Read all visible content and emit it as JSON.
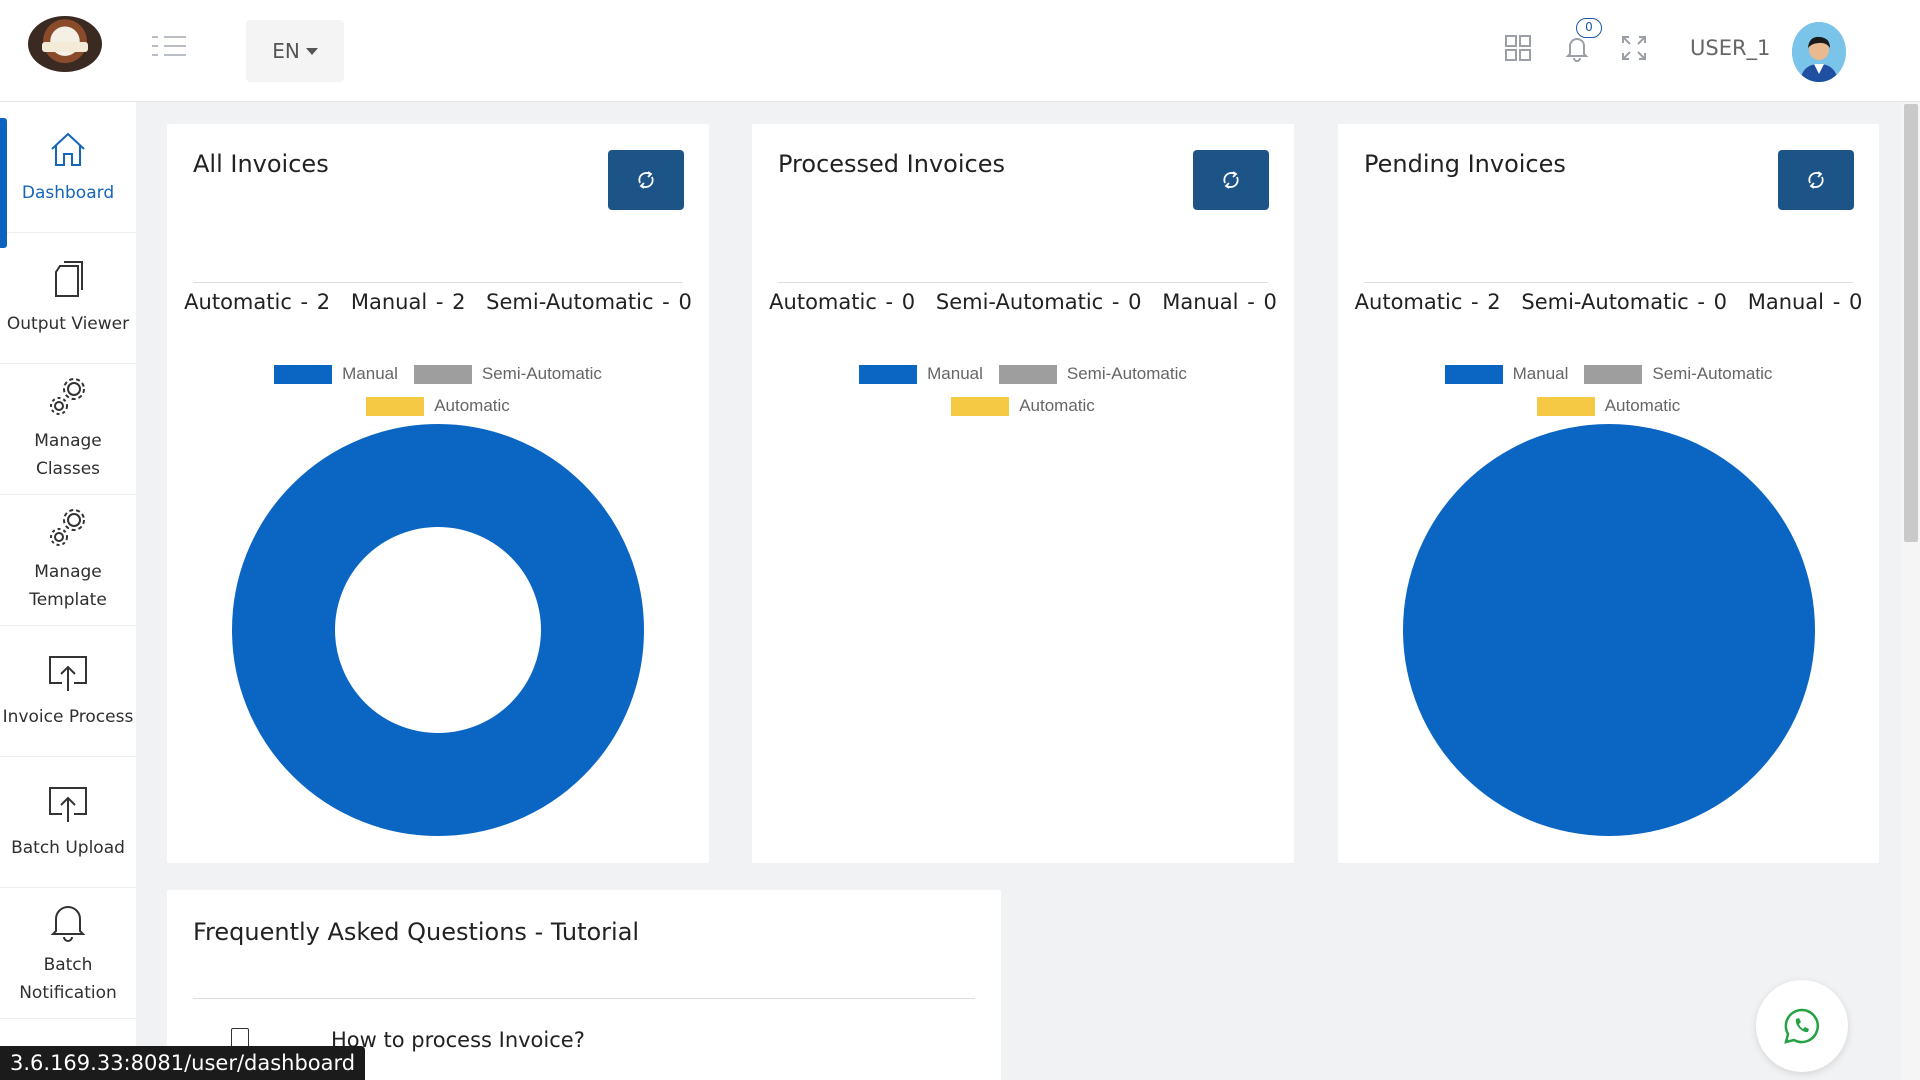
{
  "header": {
    "language": "EN",
    "notification_count": "0",
    "username": "USER_1"
  },
  "sidebar": {
    "items": [
      {
        "label": "Dashboard",
        "icon": "home-icon"
      },
      {
        "label": "Output Viewer",
        "icon": "document-icon"
      },
      {
        "label": "Manage Classes",
        "icon": "gears-icon"
      },
      {
        "label": "Manage Template",
        "icon": "gears-icon"
      },
      {
        "label": "Invoice Process",
        "icon": "upload-monitor-icon"
      },
      {
        "label": "Batch Upload",
        "icon": "upload-monitor-icon"
      },
      {
        "label": "Batch Notification",
        "icon": "bell-icon"
      }
    ]
  },
  "cards": [
    {
      "title": "All Invoices",
      "counts": [
        "Automatic - 2",
        "Manual - 2",
        "Semi-Automatic - 0"
      ]
    },
    {
      "title": "Processed Invoices",
      "counts": [
        "Automatic - 0",
        "Semi-Automatic - 0",
        "Manual - 0"
      ]
    },
    {
      "title": "Pending Invoices",
      "counts": [
        "Automatic - 2",
        "Semi-Automatic - 0",
        "Manual - 0"
      ]
    }
  ],
  "legend": {
    "manual": "Manual",
    "semi": "Semi-Automatic",
    "automatic": "Automatic"
  },
  "colors": {
    "manual": "#0b66c3",
    "semi": "#9e9e9e",
    "automatic": "#f6c945",
    "button": "#1d5488",
    "active": "#1565b8"
  },
  "chart_data": [
    {
      "type": "pie",
      "variant": "doughnut",
      "categories": [
        "Manual",
        "Semi-Automatic",
        "Automatic"
      ],
      "values": [
        2,
        0,
        0
      ]
    },
    {
      "type": "pie",
      "variant": "pie",
      "categories": [
        "Manual",
        "Semi-Automatic",
        "Automatic"
      ],
      "values": [
        0,
        0,
        0
      ]
    },
    {
      "type": "pie",
      "variant": "pie",
      "categories": [
        "Manual",
        "Semi-Automatic",
        "Automatic"
      ],
      "values": [
        2,
        0,
        0
      ]
    }
  ],
  "faq": {
    "title": "Frequently Asked Questions - Tutorial",
    "items": [
      "How to process Invoice?"
    ]
  },
  "status_url": "3.6.169.33:8081/user/dashboard"
}
